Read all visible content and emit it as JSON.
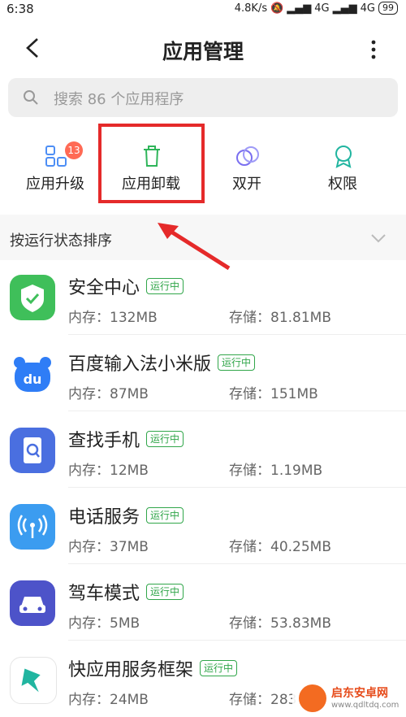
{
  "status_bar": {
    "time": "6:38",
    "speed": "4.8K/s",
    "net1": "4G",
    "net2": "4G",
    "battery": "99"
  },
  "header": {
    "title": "应用管理"
  },
  "search": {
    "placeholder": "搜索 86 个应用程序"
  },
  "tools": [
    {
      "label": "应用升级",
      "badge": "13",
      "icon": "upgrade-grid-icon"
    },
    {
      "label": "应用卸载",
      "icon": "trash-icon"
    },
    {
      "label": "双开",
      "icon": "dual-circles-icon"
    },
    {
      "label": "权限",
      "icon": "shield-badge-icon"
    }
  ],
  "sort": {
    "label": "按运行状态排序"
  },
  "apps": [
    {
      "name": "安全中心",
      "tag": "运行中",
      "mem": "内存：132MB",
      "sto": "存储：81.81MB",
      "color": "#3fbf5a"
    },
    {
      "name": "百度输入法小米版",
      "tag": "运行中",
      "mem": "内存：87MB",
      "sto": "存储：151MB",
      "color": "#2f7df6"
    },
    {
      "name": "查找手机",
      "tag": "运行中",
      "mem": "内存：12MB",
      "sto": "存储：1.19MB",
      "color": "#4a6fe0"
    },
    {
      "name": "电话服务",
      "tag": "运行中",
      "mem": "内存：37MB",
      "sto": "存储：40.25MB",
      "color": "#3b9cf0"
    },
    {
      "name": "驾车模式",
      "tag": "运行中",
      "mem": "内存：5MB",
      "sto": "存储：53.83MB",
      "color": "#4d53c9"
    },
    {
      "name": "快应用服务框架",
      "tag": "运行中",
      "mem": "内存：24MB",
      "sto": "存储：283",
      "color": "#21b5a0"
    }
  ],
  "watermark": {
    "line1": "启东安卓网",
    "line2": "www.qdltdq.com"
  }
}
